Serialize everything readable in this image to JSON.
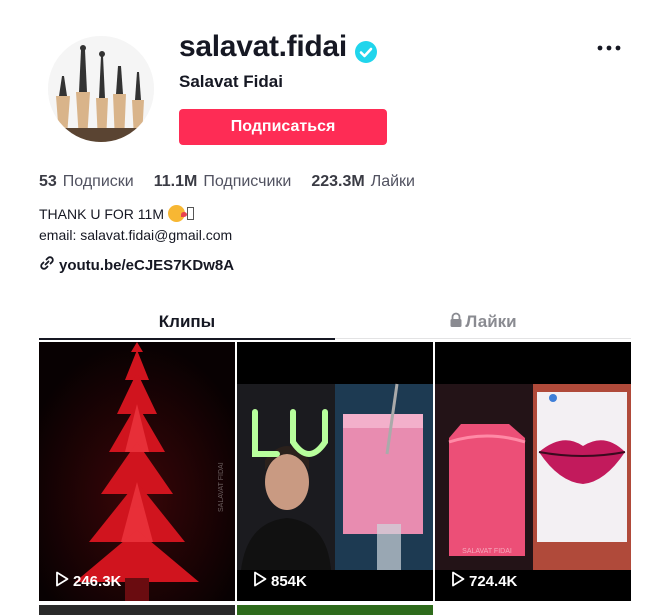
{
  "profile": {
    "username": "salavat.fidai",
    "display_name": "Salavat Fidai",
    "follow_label": "Подписаться",
    "verified_icon": "verified-badge-icon"
  },
  "stats": [
    {
      "value": "53",
      "label": "Подписки"
    },
    {
      "value": "11.1M",
      "label": "Подписчики"
    },
    {
      "value": "223.3M",
      "label": "Лайки"
    }
  ],
  "bio": {
    "line1": "THANK U FOR 11M",
    "line2": "email: salavat.fidai@gmail.com",
    "link": "youtu.be/eCJES7KDw8A"
  },
  "tabs": [
    {
      "label": "Клипы",
      "active": true
    },
    {
      "label": "Лайки",
      "active": false,
      "icon": "lock-icon"
    }
  ],
  "videos": [
    {
      "views": "246.3K",
      "watermark": "SALAVAT FIDAI"
    },
    {
      "views": "854K"
    },
    {
      "views": "724.4K",
      "watermark": "SALAVAT FIDAI"
    }
  ],
  "colors": {
    "accent": "#fe2c55",
    "verified": "#20d5ec",
    "text": "#161823"
  }
}
